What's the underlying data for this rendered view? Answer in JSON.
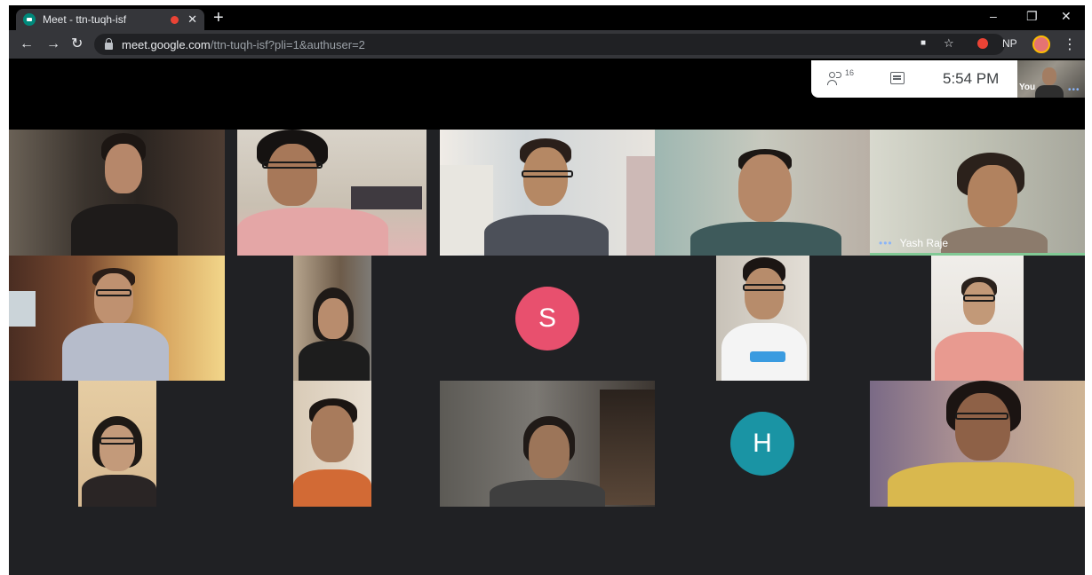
{
  "browser": {
    "tab_title": "Meet - ttn-tuqh-isf",
    "tab_close": "✕",
    "new_tab": "+",
    "window_controls": {
      "minimize": "–",
      "restore": "❐",
      "close": "✕"
    },
    "nav": {
      "back": "←",
      "forward": "→",
      "reload": "↻"
    },
    "url_domain": "meet.google.com",
    "url_path": "/ttn-tuqh-isf?pli=1&authuser=2",
    "camera_icon": "■",
    "star_icon": "☆",
    "ext_label": "NP",
    "menu": "⋮"
  },
  "meet": {
    "people_count": "16",
    "time": "5:54 PM",
    "self_label": "You",
    "self_dots": "•••",
    "tiles": [
      {
        "name": "",
        "initial": ""
      },
      {
        "name": "Yash Raje",
        "dots": "•••"
      }
    ],
    "avatars": [
      {
        "letter": "S",
        "color": "#e8506e"
      },
      {
        "letter": "H",
        "color": "#1a94a4"
      }
    ]
  }
}
